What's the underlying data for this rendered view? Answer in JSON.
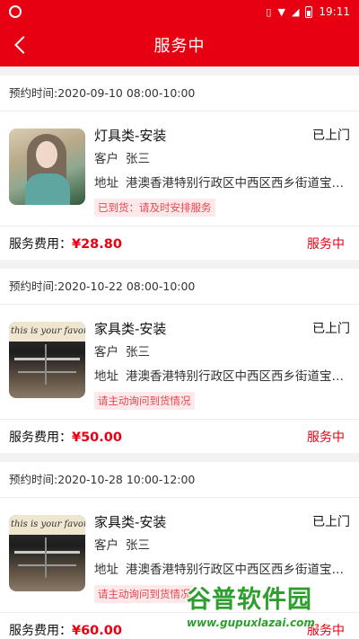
{
  "status_bar": {
    "time": "19:11"
  },
  "header": {
    "title": "服务中",
    "back_icon": "chevron-left-icon"
  },
  "orders": [
    {
      "time_label": "预约时间:2020-09-10 08:00-10:00",
      "title": "灯具类-安装",
      "state": "已上门",
      "customer_label": "客户",
      "customer": "张三",
      "address_label": "地址",
      "address": "港澳香港特别行政区中西区西乡街道宝安...",
      "tag": "已到货：请及时安排服务",
      "fee_label": "服务费用：",
      "fee": "¥28.80",
      "status": "服务中",
      "thumb": "portrait-image"
    },
    {
      "time_label": "预约时间:2020-10-22 08:00-10:00",
      "title": "家具类-安装",
      "state": "已上门",
      "customer_label": "客户",
      "customer": "张三",
      "address_label": "地址",
      "address": "港澳香港特别行政区中西区西乡街道宝安...",
      "tag": "请主动询问到货情况",
      "fee_label": "服务费用：",
      "fee": "¥50.00",
      "status": "服务中",
      "thumb": "hall-image",
      "thumb_text": "this is your favorite"
    },
    {
      "time_label": "预约时间:2020-10-28 10:00-12:00",
      "title": "家具类-安装",
      "state": "已上门",
      "customer_label": "客户",
      "customer": "张三",
      "address_label": "地址",
      "address": "港澳香港特别行政区中西区西乡街道宝安...",
      "tag": "请主动询问到货情况",
      "fee_label": "服务费用：",
      "fee": "¥60.00",
      "status": "服务中",
      "thumb": "hall-image",
      "thumb_text": "this is your favorite"
    }
  ],
  "watermark": {
    "logo": "谷普软件园",
    "url": "www.gupuxlazai.com"
  },
  "colors": {
    "brand": "#e60012",
    "tag_bg": "#fde9e9",
    "tag_text": "#e8474f"
  }
}
